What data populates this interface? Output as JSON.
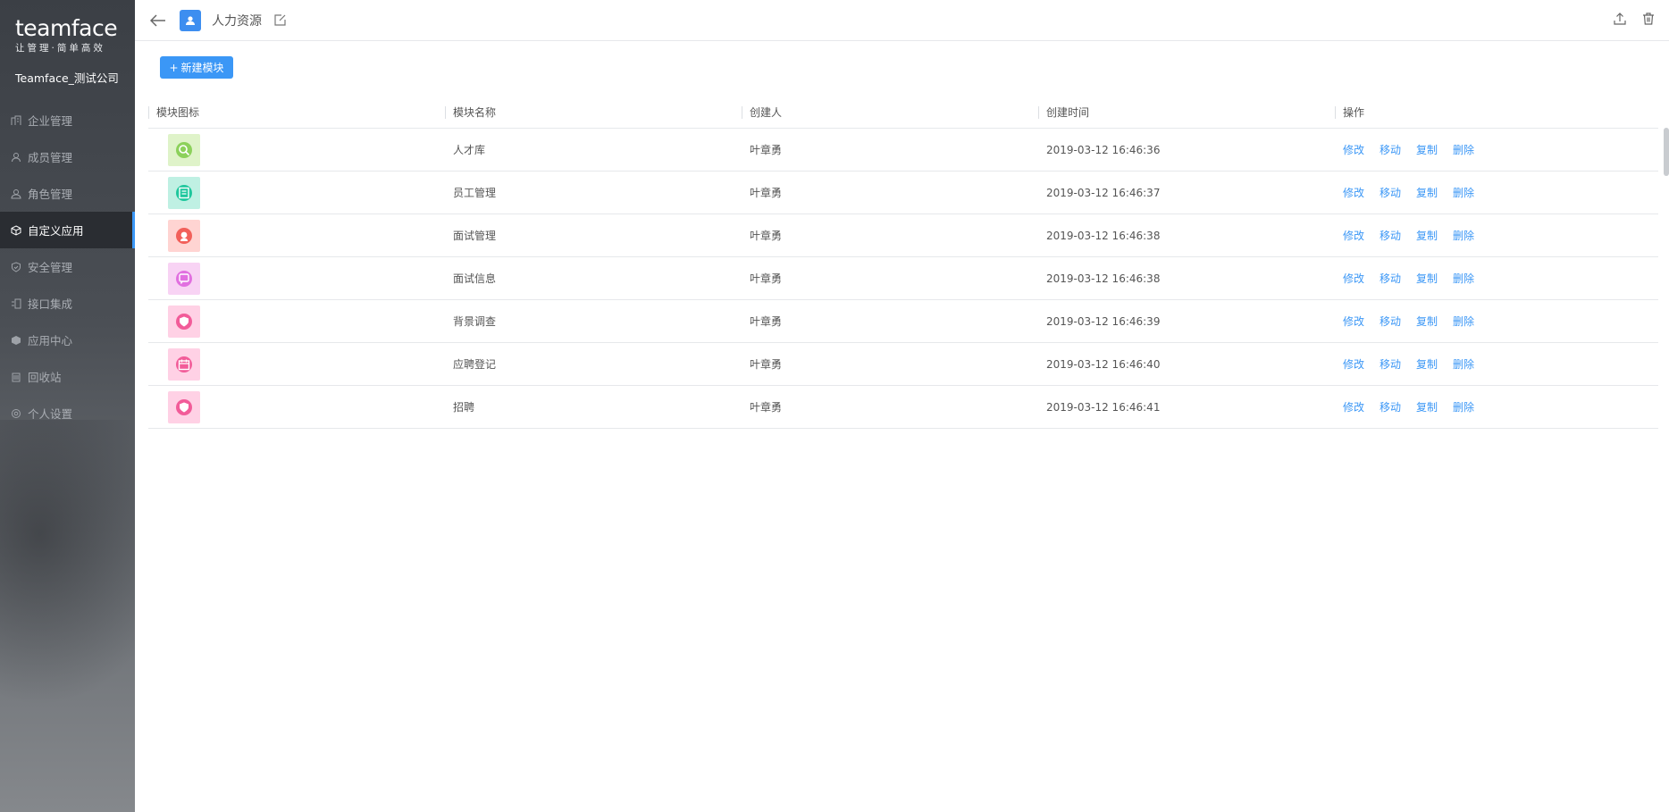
{
  "brand": {
    "logo_text": "teamface",
    "slogan": "让管理·简单高效",
    "company": "Teamface_测试公司"
  },
  "sidebar": {
    "items": [
      {
        "label": "企业管理",
        "icon": "building-icon"
      },
      {
        "label": "成员管理",
        "icon": "member-icon"
      },
      {
        "label": "角色管理",
        "icon": "role-icon"
      },
      {
        "label": "自定义应用",
        "icon": "cube-icon"
      },
      {
        "label": "安全管理",
        "icon": "shield-icon"
      },
      {
        "label": "接口集成",
        "icon": "interface-icon"
      },
      {
        "label": "应用中心",
        "icon": "app-center-icon"
      },
      {
        "label": "回收站",
        "icon": "recycle-icon"
      },
      {
        "label": "个人设置",
        "icon": "settings-icon"
      }
    ],
    "active_index": 3
  },
  "header": {
    "title": "人力资源"
  },
  "toolbar": {
    "new_button": "新建模块"
  },
  "table": {
    "columns": [
      "模块图标",
      "模块名称",
      "创建人",
      "创建时间",
      "操作"
    ],
    "actions": [
      "修改",
      "移动",
      "复制",
      "删除"
    ],
    "rows": [
      {
        "name": "人才库",
        "creator": "叶章勇",
        "created": "2019-03-12 16:46:36",
        "icon": "talent-search-icon",
        "bg": "#dff3c9",
        "fg": "#8cd15b"
      },
      {
        "name": "员工管理",
        "creator": "叶章勇",
        "created": "2019-03-12 16:46:37",
        "icon": "staff-list-icon",
        "bg": "#bff0e3",
        "fg": "#1ec79d"
      },
      {
        "name": "面试管理",
        "creator": "叶章勇",
        "created": "2019-03-12 16:46:38",
        "icon": "interview-person-icon",
        "bg": "#ffd4d2",
        "fg": "#f2605a"
      },
      {
        "name": "面试信息",
        "creator": "叶章勇",
        "created": "2019-03-12 16:46:38",
        "icon": "interview-chat-icon",
        "bg": "#f8d3f4",
        "fg": "#e170e0"
      },
      {
        "name": "背景调查",
        "creator": "叶章勇",
        "created": "2019-03-12 16:46:39",
        "icon": "background-shield-icon",
        "bg": "#ffd1e5",
        "fg": "#f25c99"
      },
      {
        "name": "应聘登记",
        "creator": "叶章勇",
        "created": "2019-03-12 16:46:40",
        "icon": "calendar-icon",
        "bg": "#ffd1e5",
        "fg": "#f25c99"
      },
      {
        "name": "招聘",
        "creator": "叶章勇",
        "created": "2019-03-12 16:46:41",
        "icon": "recruit-shield-icon",
        "bg": "#ffd1e5",
        "fg": "#f25c99"
      }
    ]
  },
  "colors": {
    "accent": "#3b97f6",
    "sidebar_bg": "#3b3f45"
  }
}
